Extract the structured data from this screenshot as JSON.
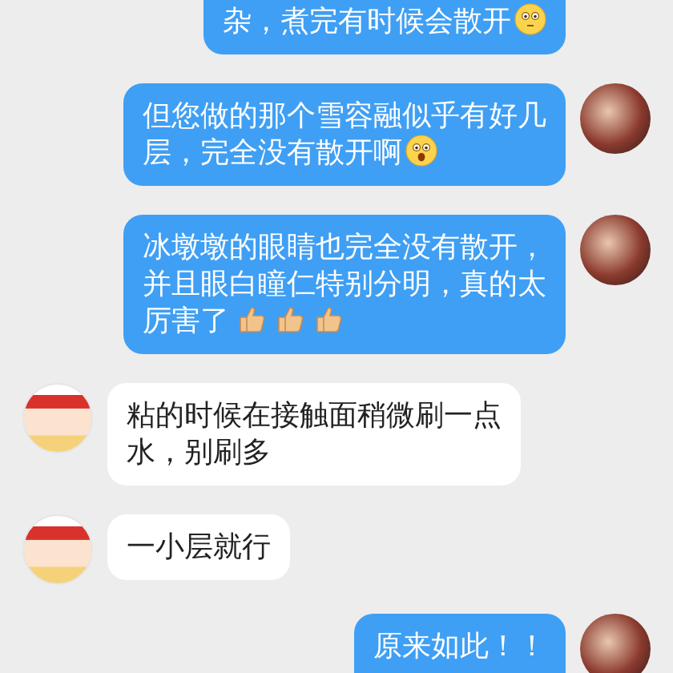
{
  "messages": [
    {
      "kind": "sent",
      "lines": [
        "杂，煮完有时候会散开"
      ],
      "emoji": [
        {
          "kind": "flushed-face"
        }
      ],
      "cut_off_top": true,
      "cut_off_bottom": false
    },
    {
      "kind": "sent",
      "lines": [
        "但您做的那个雪容融似乎有好几",
        "层，完全没有散开啊"
      ],
      "emoji": [
        {
          "kind": "shocked-face"
        }
      ],
      "cut_off_top": false,
      "cut_off_bottom": false
    },
    {
      "kind": "sent",
      "lines": [
        "冰墩墩的眼睛也完全没有散开，",
        "并且眼白瞳仁特别分明，真的太",
        "厉害了"
      ],
      "emoji": [
        {
          "kind": "thumbs-up"
        },
        {
          "kind": "thumbs-up"
        },
        {
          "kind": "thumbs-up"
        }
      ],
      "cut_off_top": false,
      "cut_off_bottom": false
    },
    {
      "kind": "received",
      "lines": [
        "粘的时候在接触面稍微刷一点",
        "水，别刷多"
      ],
      "cut_off_top": false,
      "cut_off_bottom": false
    },
    {
      "kind": "received",
      "lines": [
        "一小层就行"
      ],
      "cut_off_top": false,
      "cut_off_bottom": false
    },
    {
      "kind": "sent",
      "lines": [
        "原来如此！！"
      ],
      "cut_off_top": false,
      "cut_off_bottom": true
    }
  ]
}
